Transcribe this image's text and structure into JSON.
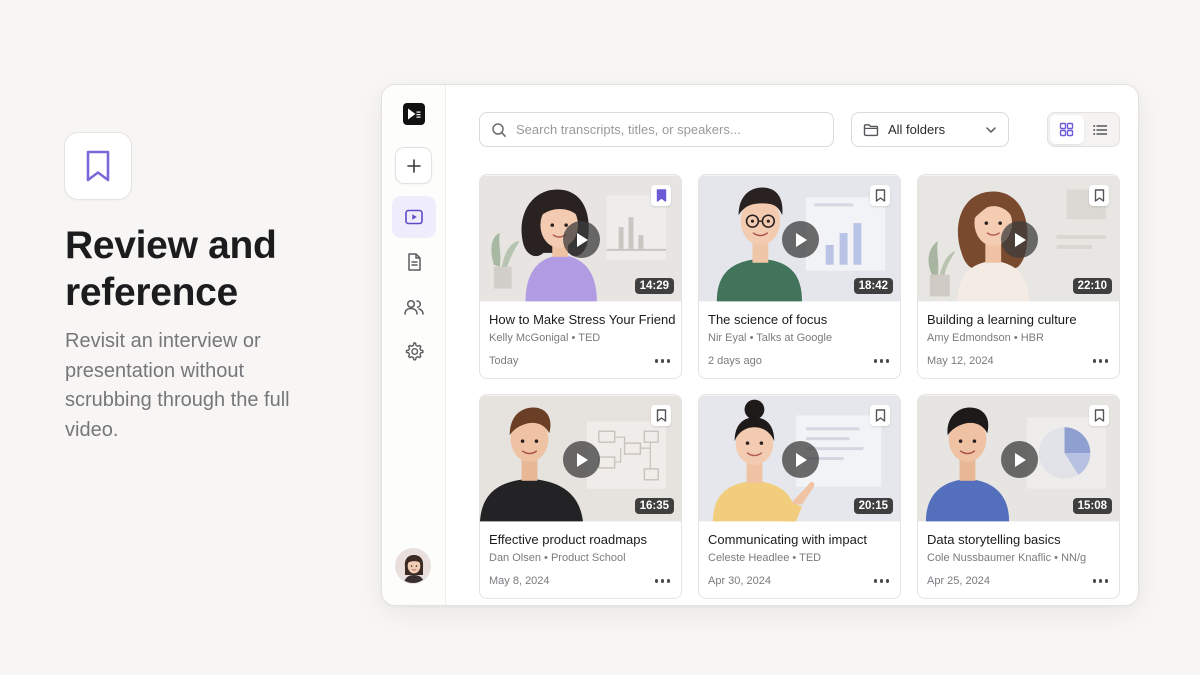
{
  "hero": {
    "title": "Review and reference",
    "description": "Revisit an interview or presentation without scrubbing through the full video."
  },
  "search": {
    "placeholder": "Search transcripts, titles, or speakers..."
  },
  "folder_filter": {
    "selected": "All folders"
  },
  "view_toggle": {
    "active": "grid"
  },
  "colors": {
    "accent": "#6b5bd6",
    "accent_soft": "#efedfb"
  },
  "videos": [
    {
      "title": "How to Make Stress Your Friend",
      "speaker": "Kelly McGonigal",
      "source": "TED",
      "date": "Today",
      "duration": "14:29",
      "bookmarked": true
    },
    {
      "title": "The science of focus",
      "speaker": "Nir Eyal",
      "source": "Talks at Google",
      "date": "2 days ago",
      "duration": "18:42",
      "bookmarked": false
    },
    {
      "title": "Building a learning culture",
      "speaker": "Amy Edmondson",
      "source": "HBR",
      "date": "May 12, 2024",
      "duration": "22:10",
      "bookmarked": false
    },
    {
      "title": "Effective product roadmaps",
      "speaker": "Dan Olsen",
      "source": "Product School",
      "date": "May 8, 2024",
      "duration": "16:35",
      "bookmarked": false
    },
    {
      "title": "Communicating with impact",
      "speaker": "Celeste Headlee",
      "source": "TED",
      "date": "Apr 30, 2024",
      "duration": "20:15",
      "bookmarked": false
    },
    {
      "title": "Data storytelling basics",
      "speaker": "Cole Nussbaumer Knaflic",
      "source": "NN/g",
      "date": "Apr 25, 2024",
      "duration": "15:08",
      "bookmarked": false
    }
  ]
}
